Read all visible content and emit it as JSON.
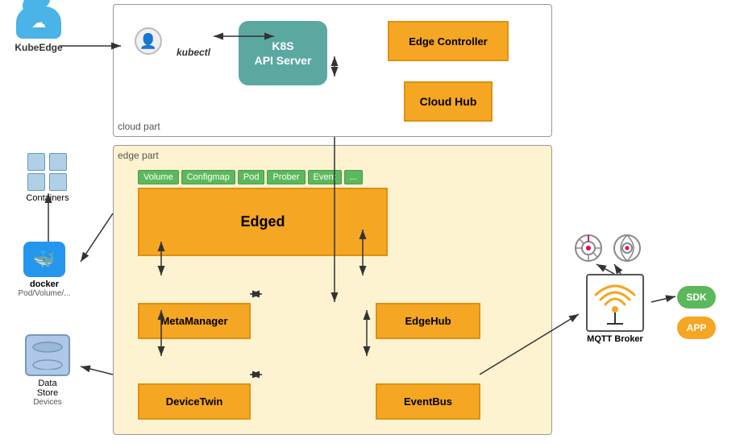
{
  "kubeedge": {
    "label": "KubeEdge"
  },
  "cloud_part": {
    "label": "cloud part",
    "k8s": "K8S\nAPI Server",
    "k8s_line1": "K8S",
    "k8s_line2": "API Server",
    "edge_controller": "Edge Controller",
    "cloud_hub": "Cloud Hub",
    "kubectl": "kubectl"
  },
  "edge_part": {
    "label": "edge part",
    "pills": [
      "Volume",
      "Configmap",
      "Pod",
      "Prober",
      "Event",
      "..."
    ],
    "edged": "Edged",
    "meta_manager": "MetaManager",
    "edge_hub": "EdgeHub",
    "device_twin": "DeviceTwin",
    "event_bus": "EventBus"
  },
  "left_side": {
    "containers": "Containers",
    "docker": "docker",
    "pod_volume": "Pod/Volume/...",
    "data_store_line1": "Data",
    "data_store_line2": "Store",
    "devices": "Devices"
  },
  "right_side": {
    "mqtt": "MQTT Broker",
    "sdk": "SDK",
    "app": "APP"
  }
}
